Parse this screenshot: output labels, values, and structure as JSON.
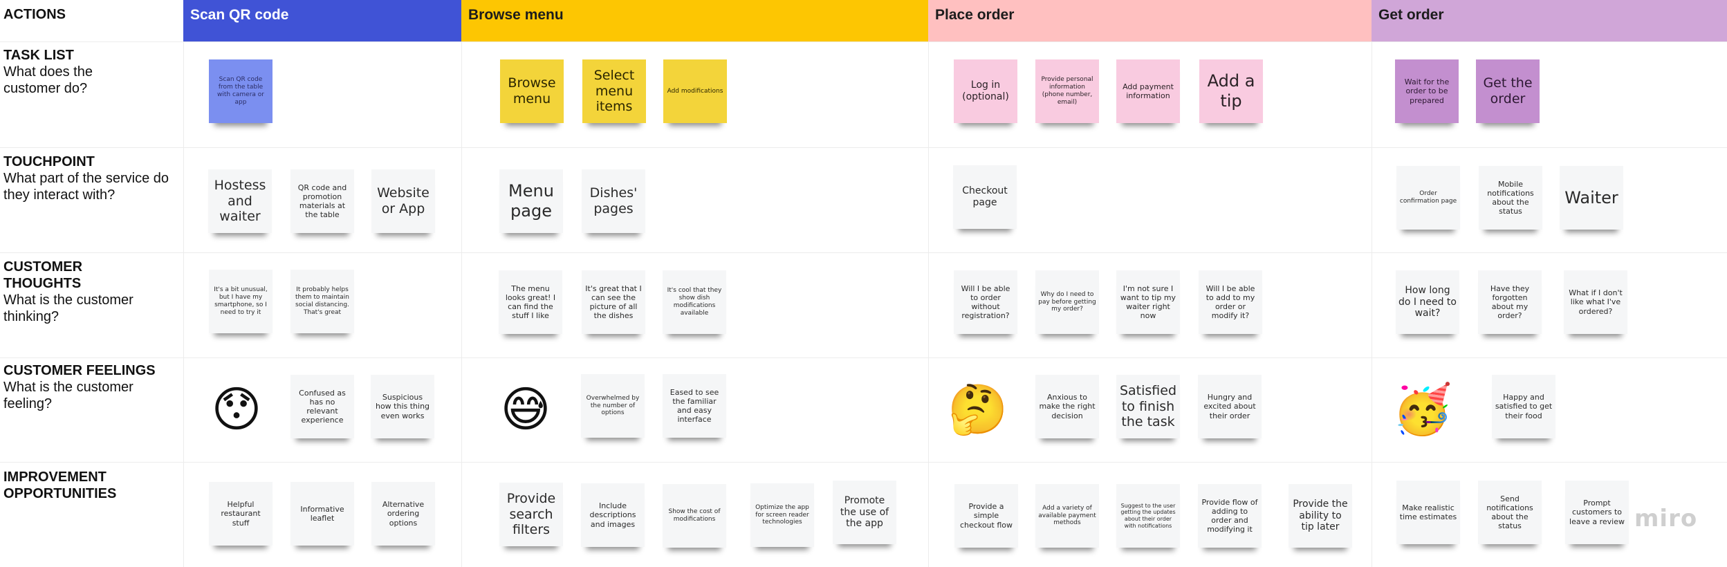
{
  "board": {
    "corner_label": "ACTIONS",
    "watermark": "miro",
    "stages": [
      {
        "label": "Scan QR code",
        "color": "#4053d6"
      },
      {
        "label": "Browse menu",
        "color": "#fdc602"
      },
      {
        "label": "Place order",
        "color": "#ffc0c0"
      },
      {
        "label": "Get order",
        "color": "#d0a6d8"
      }
    ],
    "rows": [
      {
        "title": "TASK LIST",
        "subtitle": "What does the customer do?"
      },
      {
        "title": "TOUCHPOINT",
        "subtitle": "What part of the service do they interact with?"
      },
      {
        "title": "CUSTOMER THOUGHTS",
        "subtitle": "What is the customer thinking?"
      },
      {
        "title": "CUSTOMER FEELINGS",
        "subtitle": "What is the customer feeling?"
      },
      {
        "title": "IMPROVEMENT OPPORTUNITIES",
        "subtitle": ""
      }
    ],
    "tasks": {
      "scan": [
        "Scan QR code from the table with camera or app"
      ],
      "browse": [
        "Browse menu",
        "Select menu items",
        "Add modifications"
      ],
      "place": [
        "Log in (optional)",
        "Provide personal information (phone number, email)",
        "Add payment information",
        "Add a tip"
      ],
      "get": [
        "Wait for the order to be prepared",
        "Get the order"
      ]
    },
    "touchpoints": {
      "scan": [
        "Hostess and waiter",
        "QR code and promotion materials at the table",
        "Website or App"
      ],
      "browse": [
        "Menu page",
        "Dishes' pages"
      ],
      "place": [
        "Checkout page"
      ],
      "get": [
        "Order confirmation page",
        "Mobile notifications about the status",
        "Waiter"
      ]
    },
    "thoughts": {
      "scan": [
        "It's a bit unusual, but I have my smartphone, so I need to try it",
        "It probably helps them to maintain social distancing. That's great"
      ],
      "browse": [
        "The menu looks great! I can find the stuff I like",
        "It's great that I can see the picture of all the dishes",
        "It's cool that they show dish modifications available"
      ],
      "place": [
        "Will I be able to order without registration?",
        "Why do I need to pay before getting my order?",
        "I'm not sure I want to tip my waiter right now",
        "Will I be able to add to my order or modify it?"
      ],
      "get": [
        "How long do I need to wait?",
        "Have they forgotten about my order?",
        "What if I don't like what I've ordered?"
      ]
    },
    "feelings": {
      "scan": {
        "emoji": "😯",
        "emoji_name": "hushed-face-icon",
        "notes": [
          "Confused as has no relevant experience",
          "Suspicious how this thing even works"
        ]
      },
      "browse": {
        "emoji": "😅",
        "emoji_name": "grinning-sweat-face-icon",
        "notes": [
          "Overwhelmed by the number of options",
          "Eased to see the familiar and easy interface"
        ]
      },
      "place": {
        "emoji": "🤔",
        "emoji_name": "thinking-face-icon",
        "notes": [
          "Anxious to make the right decision",
          "Satisfied to finish the task",
          "Hungry and excited about their order"
        ]
      },
      "get": {
        "emoji": "🥳",
        "emoji_name": "partying-face-icon",
        "notes": [
          "Happy and satisfied to get their food"
        ]
      }
    },
    "improvements": {
      "scan": [
        "Helpful restaurant stuff",
        "Informative leaflet",
        "Alternative ordering options"
      ],
      "browse": [
        "Provide search filters",
        "Include descriptions and images",
        "Show the cost of modifications",
        "Optimize the app for screen reader technologies",
        "Promote the use of the app"
      ],
      "place": [
        "Provide a simple checkout flow",
        "Add a variety of available payment methods",
        "Suggest to the user getting the updates about their order with notifications",
        "Provide flow of adding to order and modifying it",
        "Provide the ability to tip later"
      ],
      "get": [
        "Make realistic time estimates",
        "Send notifications about the status",
        "Prompt customers to leave a review"
      ]
    }
  }
}
